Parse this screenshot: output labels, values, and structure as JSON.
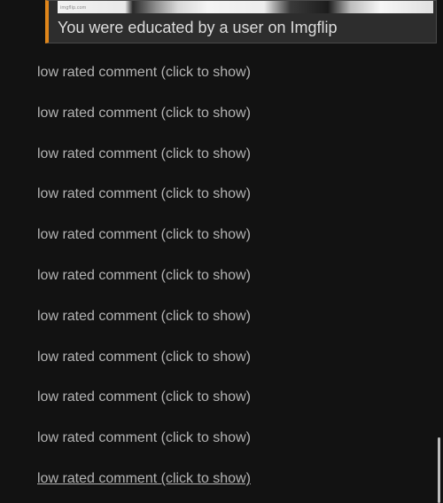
{
  "meme": {
    "watermark": "imgflip.com",
    "caption": "You were educated by a user on Imgflip"
  },
  "comments": [
    "low rated comment (click to show)",
    "low rated comment (click to show)",
    "low rated comment (click to show)",
    "low rated comment (click to show)",
    "low rated comment (click to show)",
    "low rated comment (click to show)",
    "low rated comment (click to show)",
    "low rated comment (click to show)",
    "low rated comment (click to show)",
    "low rated comment (click to show)",
    "low rated comment (click to show)"
  ],
  "colors": {
    "background": "#121212",
    "accent": "#e0861a",
    "text": "#b3b3b3"
  }
}
